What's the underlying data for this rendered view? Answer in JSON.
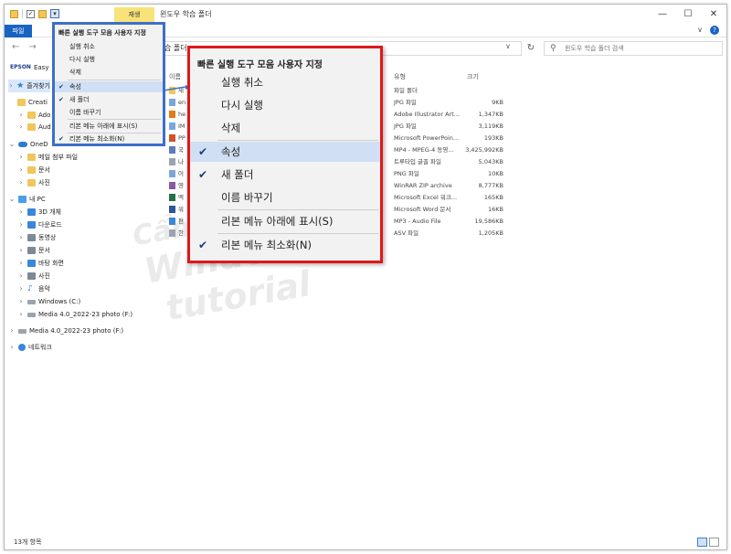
{
  "window": {
    "title": "윈도우 학습 폴더",
    "manage_tab": "재생",
    "controls": [
      "—",
      "☐",
      "✕"
    ]
  },
  "ribbon": {
    "file_tab": "파일",
    "collapse_glyph": "∨",
    "help_glyph": "?"
  },
  "address": {
    "path": "습 폴더",
    "search_placeholder": "윈도우 학습 폴더 검색"
  },
  "nav": {
    "epson": "EPSON",
    "easy": "Easy",
    "items": [
      {
        "label": "즐겨찾기"
      },
      {
        "label": "Creati"
      },
      {
        "label": "Ado"
      },
      {
        "label": "Aud"
      },
      {
        "label": "OneD"
      },
      {
        "label": "메일 첨부 파일"
      },
      {
        "label": "문서"
      },
      {
        "label": "사진"
      },
      {
        "label": "내 PC"
      },
      {
        "label": "3D 개체"
      },
      {
        "label": "다운로드"
      },
      {
        "label": "동영상"
      },
      {
        "label": "문서"
      },
      {
        "label": "바탕 화면"
      },
      {
        "label": "사진"
      },
      {
        "label": "음악"
      },
      {
        "label": "Windows (C:)"
      },
      {
        "label": "Media 4.0_2022-23 photo (F:)"
      },
      {
        "label": "Media 4.0_2022-23 photo (F:)"
      },
      {
        "label": "네트워크"
      }
    ]
  },
  "columns": {
    "name": "이름",
    "type": "유형",
    "size": "크기"
  },
  "files": [
    {
      "name": "새",
      "type": "파일 폴더",
      "size": ""
    },
    {
      "name": "en",
      "type": "JPG 파일",
      "size": "9KB"
    },
    {
      "name": "he",
      "type": "Adobe Illustrator Art...",
      "size": "1,347KB"
    },
    {
      "name": "IM",
      "type": "JPG 파일",
      "size": "3,119KB"
    },
    {
      "name": "PP",
      "type": "Microsoft PowerPoin...",
      "size": "193KB"
    },
    {
      "name": "국",
      "type": "MP4 - MPEG-4 동영...",
      "size": "3,425,992KB"
    },
    {
      "name": "나",
      "type": "트루타입 글꼴 파일",
      "size": "5,043KB"
    },
    {
      "name": "어",
      "type": "PNG 파일",
      "size": "10KB"
    },
    {
      "name": "영",
      "type": "WinRAR ZIP archive",
      "size": "8,777KB"
    },
    {
      "name": "엑",
      "type": "Microsoft Excel 워크...",
      "size": "165KB"
    },
    {
      "name": "워",
      "type": "Microsoft Word 문서",
      "size": "16KB"
    },
    {
      "name": "편",
      "type": "MP3 - Audio File",
      "size": "19,586KB"
    },
    {
      "name": "한",
      "type": "ASV 파일",
      "size": "1,205KB"
    }
  ],
  "small_menu": {
    "title": "빠른 실행 도구 모음 사용자 지정",
    "items": [
      {
        "label": "실행 취소",
        "checked": false
      },
      {
        "label": "다시 실행",
        "checked": false
      },
      {
        "label": "삭제",
        "checked": false
      },
      {
        "label": "속성",
        "checked": true
      },
      {
        "label": "새 폴더",
        "checked": true
      },
      {
        "label": "이름 바꾸기",
        "checked": false
      },
      {
        "label": "리본 메뉴 아래에 표시(S)",
        "checked": false
      },
      {
        "label": "리본 메뉴 최소화(N)",
        "checked": true
      }
    ]
  },
  "big_menu": {
    "title": "빠른 실행 도구 모음 사용자 지정",
    "items": [
      {
        "label": "실행 취소",
        "checked": false
      },
      {
        "label": "다시 실행",
        "checked": false
      },
      {
        "label": "삭제",
        "checked": false
      },
      {
        "label": "속성",
        "checked": true
      },
      {
        "label": "새 폴더",
        "checked": true
      },
      {
        "label": "이름 바꾸기",
        "checked": false
      },
      {
        "label": "리본 메뉴 아래에 표시(S)",
        "checked": false
      },
      {
        "label": "리본 메뉴 최소화(N)",
        "checked": true
      }
    ]
  },
  "status": {
    "item_count": "13개 항목"
  },
  "watermark": {
    "line1": "Cẩm",
    "line2": "Windows 10",
    "line3": "tutorial"
  },
  "colors": {
    "accent": "#1a64c1",
    "blue_box": "#3d6fc7",
    "red_box": "#e01717",
    "manage_tab": "#f7e37a",
    "highlight": "#d0dff3"
  }
}
